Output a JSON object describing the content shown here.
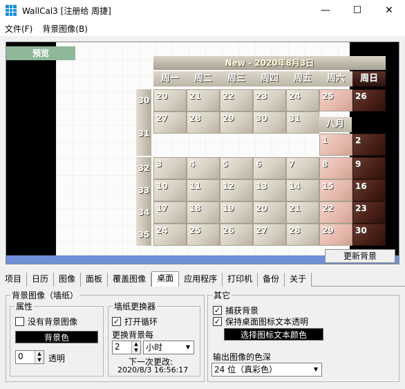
{
  "window": {
    "title": "WallCal3 [注册给 周捷]",
    "controls": {
      "minimize": "—",
      "maximize": "☐",
      "close": "✕"
    }
  },
  "menu": [
    "文件(F)",
    "背景图像(B)"
  ],
  "preview": {
    "tag": "预览",
    "calendar_title": "New - 2020年8月3日",
    "day_headers": [
      "周一",
      "周二",
      "周三",
      "周四",
      "周五",
      "周六",
      "周日"
    ],
    "prev_month": {
      "week_numbers": [
        "30",
        "31"
      ],
      "rows": [
        [
          "20",
          "21",
          "22",
          "23",
          "24",
          "25",
          "26"
        ],
        [
          "27",
          "28",
          "29",
          "30",
          "31",
          "",
          ""
        ]
      ]
    },
    "month_label": "八月",
    "aug_first_row": [
      "1",
      "2"
    ],
    "cur_month": {
      "week_numbers": [
        "32",
        "33",
        "34",
        "35"
      ],
      "rows": [
        [
          "3",
          "4",
          "5",
          "6",
          "7",
          "8",
          "9"
        ],
        [
          "10",
          "11",
          "12",
          "13",
          "14",
          "15",
          "16"
        ],
        [
          "17",
          "18",
          "19",
          "20",
          "21",
          "22",
          "23"
        ],
        [
          "24",
          "25",
          "26",
          "27",
          "28",
          "29",
          "30"
        ]
      ]
    },
    "update_background_button": "更新背景"
  },
  "tabs": [
    "项目",
    "日历",
    "图像",
    "面板",
    "覆盖图像",
    "桌面",
    "应用程序",
    "打印机",
    "备份",
    "关于"
  ],
  "active_tab": "桌面",
  "wallpaper_group": {
    "legend": "背景图像（墙纸）",
    "attributes": {
      "legend": "属性",
      "no_bg_image_label": "没有背景图像",
      "no_bg_image_checked": false,
      "bg_color_button": "背景色",
      "transparency_value": "0",
      "transparency_label": "透明"
    },
    "changer": {
      "legend": "墙纸更换器",
      "loop_label": "打开循环",
      "loop_checked": true,
      "change_every_label": "更换背景每",
      "interval_value": "2",
      "interval_unit": "小时",
      "next_change_label": "下一次更改:",
      "next_change_time": "2020/8/3 16:56:17"
    }
  },
  "other_group": {
    "legend": "其它",
    "capture_bg_label": "捕获背景",
    "capture_bg_checked": true,
    "keep_transparent_label": "保持桌面图标文本透明",
    "keep_transparent_checked": true,
    "icon_text_color_button": "选择图标文本颜色",
    "color_depth_label": "输出图像的色深",
    "color_depth_value": "24 位（真彩色）"
  }
}
